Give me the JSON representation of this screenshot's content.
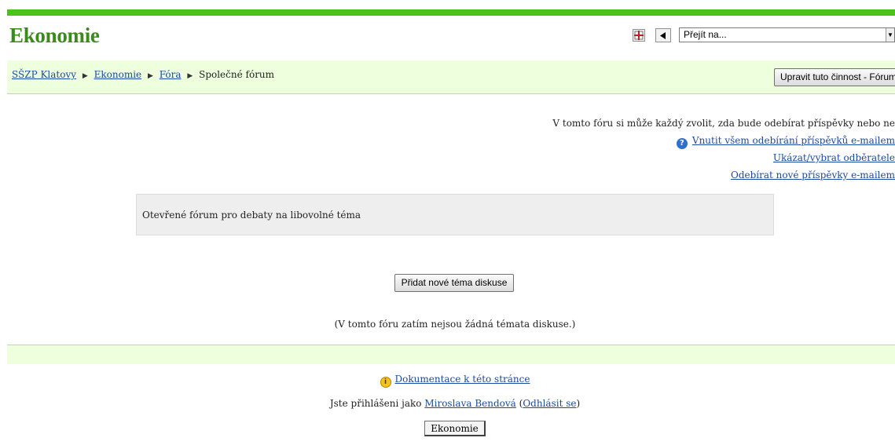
{
  "header": {
    "title": "Ekonomie",
    "jump_select_value": "Přejít na..."
  },
  "navbar": {
    "breadcrumb": [
      {
        "label": "SŠZP Klatovy",
        "link": true
      },
      {
        "label": "Ekonomie",
        "link": true
      },
      {
        "label": "Fóra",
        "link": true
      },
      {
        "label": "Společné fórum",
        "link": false
      }
    ],
    "edit_button": "Upravit tuto činnost - Fórum"
  },
  "subscription": {
    "notice": "V tomto fóru si může každý zvolit, zda bude odebírat příspěvky nebo ne",
    "force_link": "Vnutit všem odebírání příspěvků e-mailem",
    "show_link": "Ukázat/vybrat odběratele",
    "subscribe_link": "Odebírat nové příspěvky e-mailem"
  },
  "forum": {
    "intro": "Otevřené fórum pro debaty na libovolné téma",
    "add_button": "Přidat nové téma diskuse",
    "empty_note": "(V tomto fóru zatím nejsou žádná témata diskuse.)"
  },
  "footer": {
    "doc_link": "Dokumentace k této stránce",
    "login_prefix": "Jste přihlášeni jako ",
    "user_name": "Miroslava Bendová",
    "logout_open": " (",
    "logout_link": "Odhlásit se",
    "logout_close": ")",
    "home_button": "Ekonomie"
  },
  "colors": {
    "accent_green": "#4cc31c",
    "title_green": "#3c8a1e",
    "nav_bg": "#eeffdd",
    "link_blue": "#1c4aa0"
  }
}
